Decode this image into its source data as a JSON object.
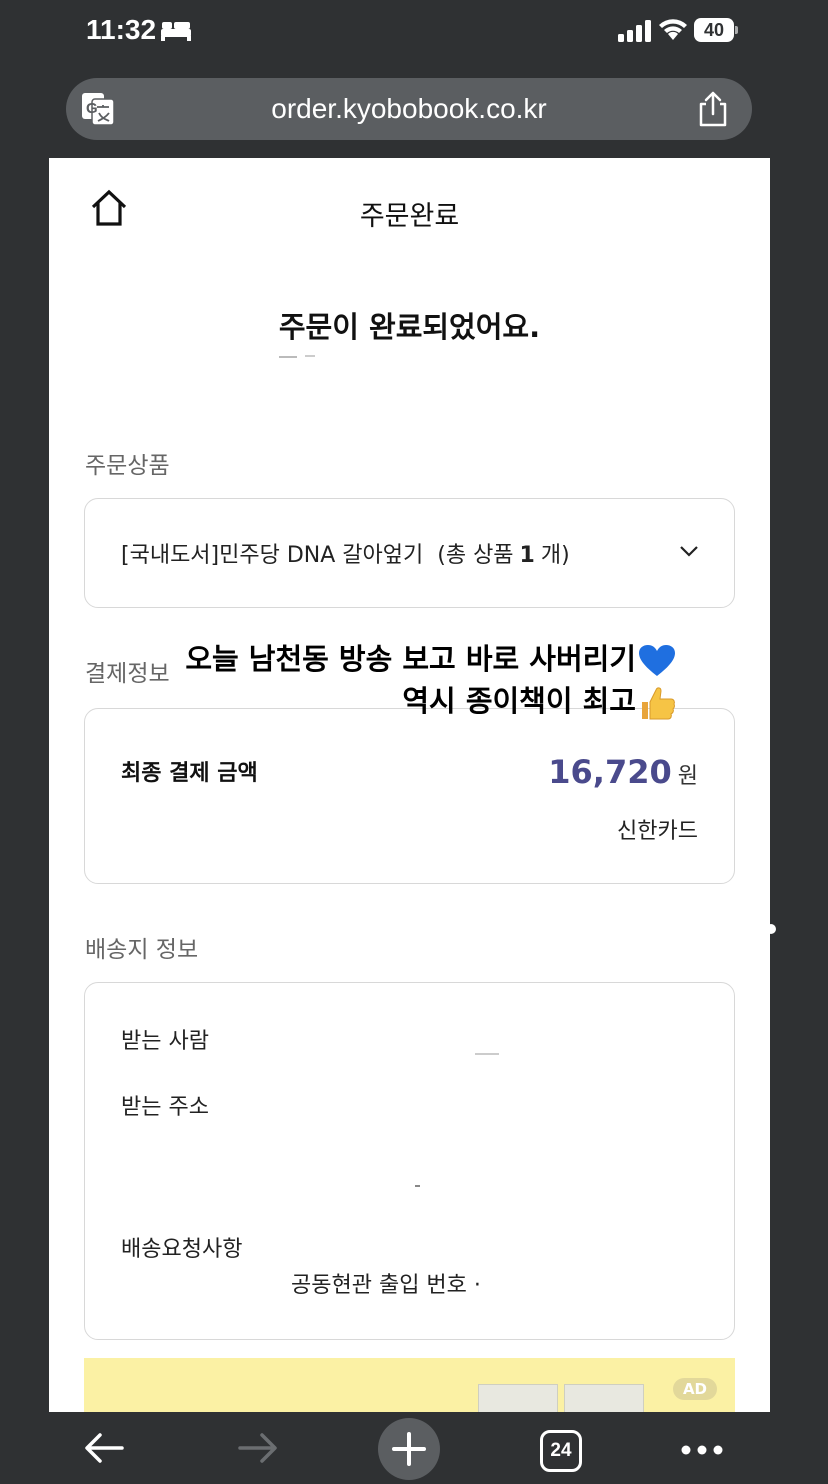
{
  "status_bar": {
    "time": "11:32",
    "battery": "40"
  },
  "browser": {
    "url": "order.kyobobook.co.kr",
    "tab_count": "24"
  },
  "header": {
    "title": "주문완료"
  },
  "main": {
    "complete_message": "주문이 완료되었어요.",
    "order_items": {
      "label": "주문상품",
      "product": "[국내도서]민주당 DNA 갈아엎기",
      "count_prefix": "(총 상품",
      "count_value": "1",
      "count_suffix": "개)"
    },
    "payment": {
      "label": "결제정보",
      "final_label": "최종 결제 금액",
      "amount": "16,720",
      "unit": "원",
      "method": "신한카드"
    },
    "delivery": {
      "label": "배송지 정보",
      "recipient_label": "받는 사람",
      "address_label": "받는 주소",
      "request_label": "배송요청사항",
      "request_value": "공동현관 출입 번호 ·"
    },
    "ad": {
      "badge": "AD"
    }
  },
  "overlay": {
    "line1": "오늘 남천동 방송 보고 바로 사버리기",
    "line2": "역시 종이책이 최고"
  },
  "colors": {
    "amount": "#4a4a8c",
    "ad_banner": "#fbf1a4",
    "browser_chrome": "#2f3133"
  }
}
